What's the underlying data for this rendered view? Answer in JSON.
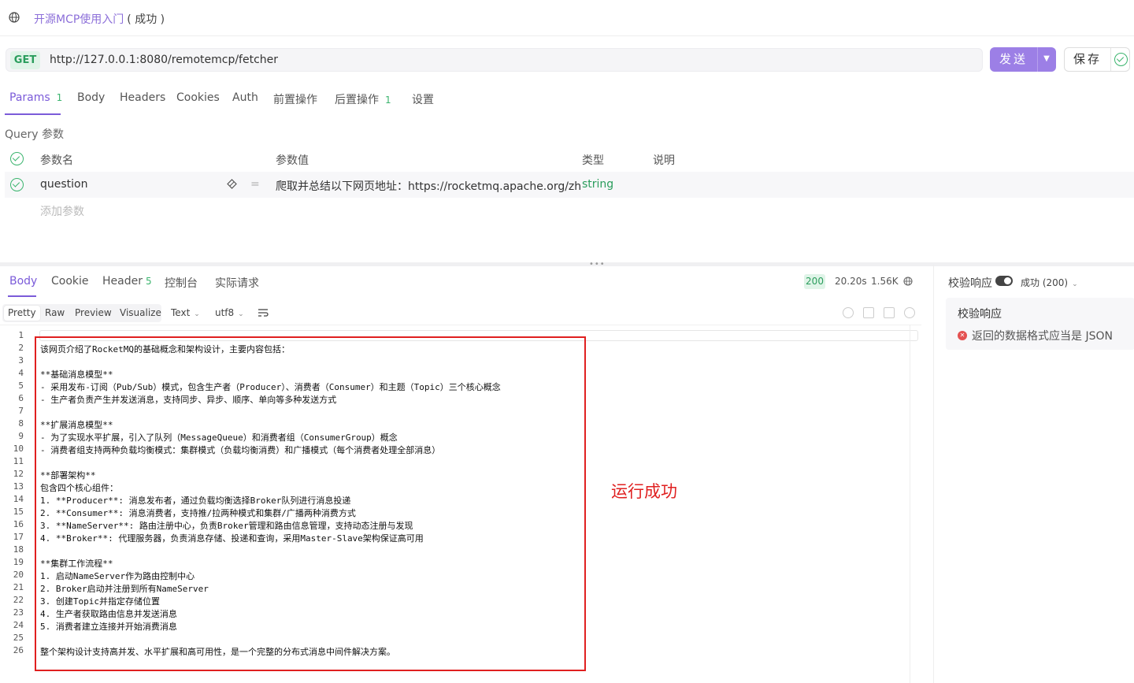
{
  "header": {
    "title": "开源MCP使用入门",
    "status": "( 成功 )"
  },
  "request": {
    "method": "GET",
    "url": "http://127.0.0.1:8080/remotemcp/fetcher",
    "send_label": "发送",
    "save_label": "保存"
  },
  "req_tabs": [
    {
      "label": "Params",
      "count": "1"
    },
    {
      "label": "Body"
    },
    {
      "label": "Headers"
    },
    {
      "label": "Cookies"
    },
    {
      "label": "Auth"
    },
    {
      "label": "前置操作"
    },
    {
      "label": "后置操作",
      "count": "1"
    },
    {
      "label": "设置"
    }
  ],
  "query": {
    "label": "Query 参数",
    "headers": {
      "name": "参数名",
      "value": "参数值",
      "type": "类型",
      "desc": "说明"
    },
    "row": {
      "name": "question",
      "eq": "=",
      "value": "爬取并总结以下网页地址：https://rocketmq.apache.org/zh",
      "type": "string"
    },
    "add_label": "添加参数"
  },
  "resp_tabs": [
    {
      "label": "Body"
    },
    {
      "label": "Cookie"
    },
    {
      "label": "Header",
      "count": "5"
    },
    {
      "label": "控制台"
    },
    {
      "label": "实际请求"
    }
  ],
  "resp_meta": {
    "status": "200",
    "time": "20.20s",
    "size": "1.56K"
  },
  "view_modes": [
    "Pretty",
    "Raw",
    "Preview",
    "Visualize"
  ],
  "format": {
    "type": "Text",
    "encoding": "utf8"
  },
  "code_lines": [
    "",
    "该网页介绍了RocketMQ的基础概念和架构设计，主要内容包括：",
    "",
    "**基础消息模型**",
    "- 采用发布-订阅（Pub/Sub）模式，包含生产者（Producer）、消费者（Consumer）和主题（Topic）三个核心概念",
    "- 生产者负责产生并发送消息，支持同步、异步、顺序、单向等多种发送方式",
    "",
    "**扩展消息模型**",
    "- 为了实现水平扩展，引入了队列（MessageQueue）和消费者组（ConsumerGroup）概念",
    "- 消费者组支持两种负载均衡模式：集群模式（负载均衡消费）和广播模式（每个消费者处理全部消息）",
    "",
    "**部署架构**",
    "包含四个核心组件：",
    "1. **Producer**: 消息发布者，通过负载均衡选择Broker队列进行消息投递",
    "2. **Consumer**: 消息消费者，支持推/拉两种模式和集群/广播两种消费方式",
    "3. **NameServer**: 路由注册中心，负责Broker管理和路由信息管理，支持动态注册与发现",
    "4. **Broker**: 代理服务器，负责消息存储、投递和查询，采用Master-Slave架构保证高可用",
    "",
    "**集群工作流程**",
    "1. 启动NameServer作为路由控制中心",
    "2. Broker启动并注册到所有NameServer",
    "3. 创建Topic并指定存储位置",
    "4. 生产者获取路由信息并发送消息",
    "5. 消费者建立连接并开始消费消息",
    "",
    "整个架构设计支持高并发、水平扩展和高可用性，是一个完整的分布式消息中间件解决方案。"
  ],
  "annotation": "运行成功",
  "validation": {
    "label": "校验响应",
    "status": "成功 (200)",
    "card_title": "校验响应",
    "message": "返回的数据格式应当是 JSON"
  }
}
